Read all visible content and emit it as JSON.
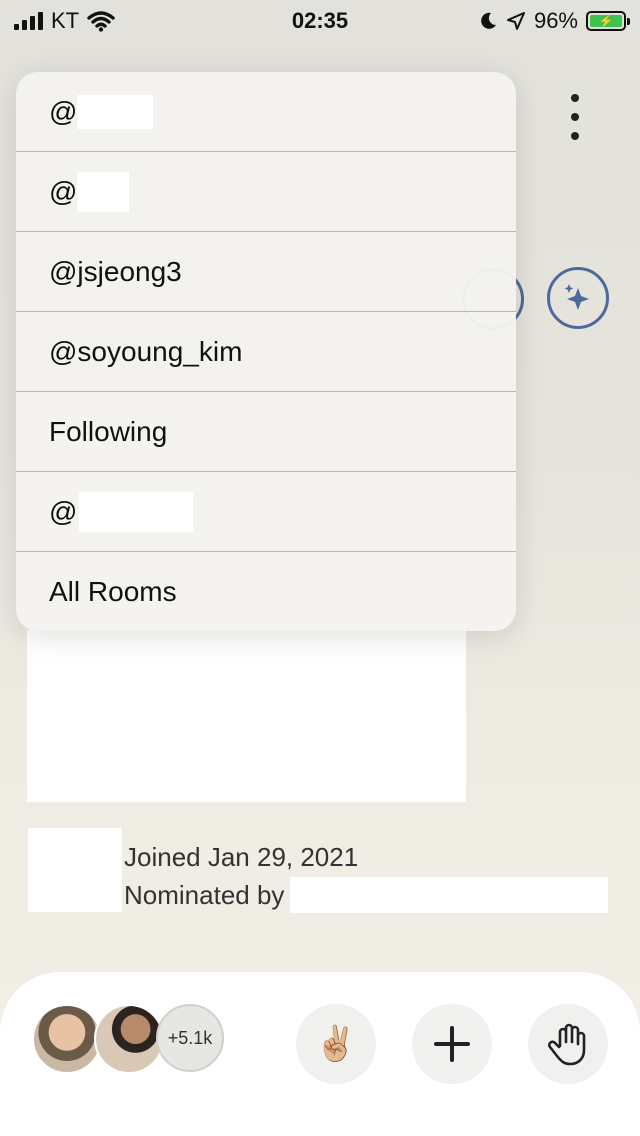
{
  "status_bar": {
    "carrier": "KT",
    "time": "02:35",
    "battery": "96%"
  },
  "dropdown": {
    "items": [
      {
        "prefix": "@",
        "label": ""
      },
      {
        "prefix": "@",
        "label": ""
      },
      {
        "prefix": "",
        "label": "@jsjeong3"
      },
      {
        "prefix": "",
        "label": "@soyoung_kim"
      },
      {
        "prefix": "",
        "label": "Following"
      },
      {
        "prefix": "@",
        "label": ""
      },
      {
        "prefix": "",
        "label": "All Rooms"
      }
    ]
  },
  "profile": {
    "joined": "Joined Jan 29, 2021",
    "nominated": "Nominated by"
  },
  "bottom_bar": {
    "count": "+5.1k",
    "peace_icon": "✌🏼",
    "add_icon": "plus-icon",
    "hand_icon": "raise-hand-icon"
  },
  "colors": {
    "accent_blue": "#4e6a9b",
    "battery_green": "#3fc24f"
  }
}
